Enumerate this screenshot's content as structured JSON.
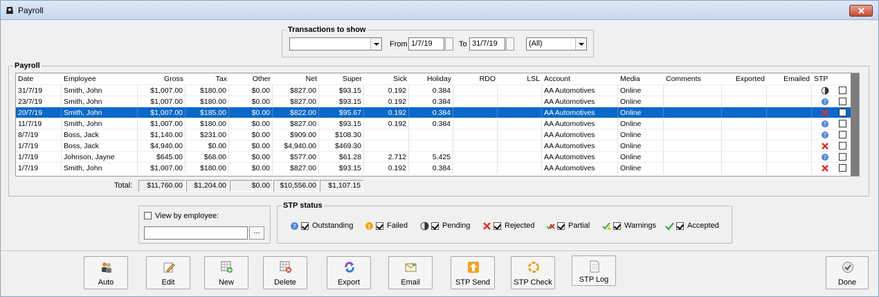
{
  "window": {
    "title": "Payroll",
    "close_label": "x"
  },
  "filter": {
    "legend": "Transactions to show",
    "type_value": "",
    "from_label": "From",
    "from_value": "1/7/19",
    "to_label": "To",
    "to_value": "31/7/19",
    "scope_value": "(All)"
  },
  "payroll": {
    "legend": "Payroll",
    "columns": [
      "Date",
      "Employee",
      "Gross",
      "Tax",
      "Other",
      "Net",
      "Super",
      "Sick",
      "Holiday",
      "RDO",
      "LSL",
      "Account",
      "Media",
      "Comments",
      "Exported",
      "Emailed",
      "STP"
    ],
    "rows": [
      {
        "date": "31/7/19",
        "employee": "Smith, John",
        "gross": "$1,007.00",
        "tax": "$180.00",
        "other": "$0.00",
        "net": "$827.00",
        "super": "$93.15",
        "sick": "0.192",
        "holiday": "0.384",
        "rdo": "",
        "lsl": "",
        "account": "AA Automotives",
        "media": "Online",
        "comments": "",
        "exported": "",
        "emailed": "",
        "stp": "pending"
      },
      {
        "date": "23/7/19",
        "employee": "Smith, John",
        "gross": "$1,007.00",
        "tax": "$180.00",
        "other": "$0.00",
        "net": "$827.00",
        "super": "$93.15",
        "sick": "0.192",
        "holiday": "0.384",
        "rdo": "",
        "lsl": "",
        "account": "AA Automotives",
        "media": "Online",
        "comments": "",
        "exported": "",
        "emailed": "",
        "stp": "outstanding"
      },
      {
        "date": "20/7/19",
        "employee": "Smith, John",
        "gross": "$1,007.00",
        "tax": "$185.00",
        "other": "$0.00",
        "net": "$822.00",
        "super": "$95.67",
        "sick": "0.192",
        "holiday": "0.384",
        "rdo": "",
        "lsl": "",
        "account": "AA Automotives",
        "media": "Online",
        "comments": "",
        "exported": "",
        "emailed": "",
        "stp": "rejected"
      },
      {
        "date": "11/7/19",
        "employee": "Smith, John",
        "gross": "$1,007.00",
        "tax": "$180.00",
        "other": "$0.00",
        "net": "$827.00",
        "super": "$93.15",
        "sick": "0.192",
        "holiday": "0.384",
        "rdo": "",
        "lsl": "",
        "account": "AA Automotives",
        "media": "Online",
        "comments": "",
        "exported": "",
        "emailed": "",
        "stp": "outstanding"
      },
      {
        "date": "8/7/19",
        "employee": "Boss, Jack",
        "gross": "$1,140.00",
        "tax": "$231.00",
        "other": "$0.00",
        "net": "$909.00",
        "super": "$108.30",
        "sick": "",
        "holiday": "",
        "rdo": "",
        "lsl": "",
        "account": "AA Automotives",
        "media": "Online",
        "comments": "",
        "exported": "",
        "emailed": "",
        "stp": "outstanding"
      },
      {
        "date": "1/7/19",
        "employee": "Boss, Jack",
        "gross": "$4,940.00",
        "tax": "$0.00",
        "other": "$0.00",
        "net": "$4,940.00",
        "super": "$469.30",
        "sick": "",
        "holiday": "",
        "rdo": "",
        "lsl": "",
        "account": "AA Automotives",
        "media": "Online",
        "comments": "",
        "exported": "",
        "emailed": "",
        "stp": "rejected"
      },
      {
        "date": "1/7/19",
        "employee": "Johnson, Jayne",
        "gross": "$645.00",
        "tax": "$68.00",
        "other": "$0.00",
        "net": "$577.00",
        "super": "$61.28",
        "sick": "2.712",
        "holiday": "5.425",
        "rdo": "",
        "lsl": "",
        "account": "AA Automotives",
        "media": "Online",
        "comments": "",
        "exported": "",
        "emailed": "",
        "stp": "outstanding"
      },
      {
        "date": "1/7/19",
        "employee": "Smith, John",
        "gross": "$1,007.00",
        "tax": "$180.00",
        "other": "$0.00",
        "net": "$827.00",
        "super": "$93.15",
        "sick": "0.192",
        "holiday": "0.384",
        "rdo": "",
        "lsl": "",
        "account": "AA Automotives",
        "media": "Online",
        "comments": "",
        "exported": "",
        "emailed": "",
        "stp": "rejected"
      }
    ],
    "selected_row": 2,
    "totals": {
      "label": "Total:",
      "gross": "$11,760.00",
      "tax": "$1,204.00",
      "other": "$0.00",
      "net": "$10,556.00",
      "super": "$1,107.15"
    }
  },
  "view_by_employee": {
    "label": "View by employee:",
    "value": "",
    "browse_label": "..."
  },
  "stp_status": {
    "legend": "STP status",
    "items": [
      {
        "label": "Outstanding",
        "icon": "info-circle-icon",
        "checked": true
      },
      {
        "label": "Failed",
        "icon": "warning-circle-icon",
        "checked": true
      },
      {
        "label": "Pending",
        "icon": "pending-icon",
        "checked": true
      },
      {
        "label": "Rejected",
        "icon": "red-cross-icon",
        "checked": true
      },
      {
        "label": "Partial",
        "icon": "partial-icon",
        "checked": true
      },
      {
        "label": "Warnings",
        "icon": "tick-warning-icon",
        "checked": true
      },
      {
        "label": "Accepted",
        "icon": "green-tick-icon",
        "checked": true
      }
    ]
  },
  "toolbar": {
    "auto": "Auto",
    "edit": "Edit",
    "new": "New",
    "delete": "Delete",
    "export": "Export",
    "email": "Email",
    "stp_send": "STP Send",
    "stp_check": "STP Check",
    "stp_log": "STP Log",
    "done": "Done"
  },
  "colors": {
    "selection": "#0a68c8",
    "rejected": "#e0312a",
    "outstanding": "#4f86d8",
    "accepted": "#4caf50",
    "failed": "#f2a318"
  }
}
